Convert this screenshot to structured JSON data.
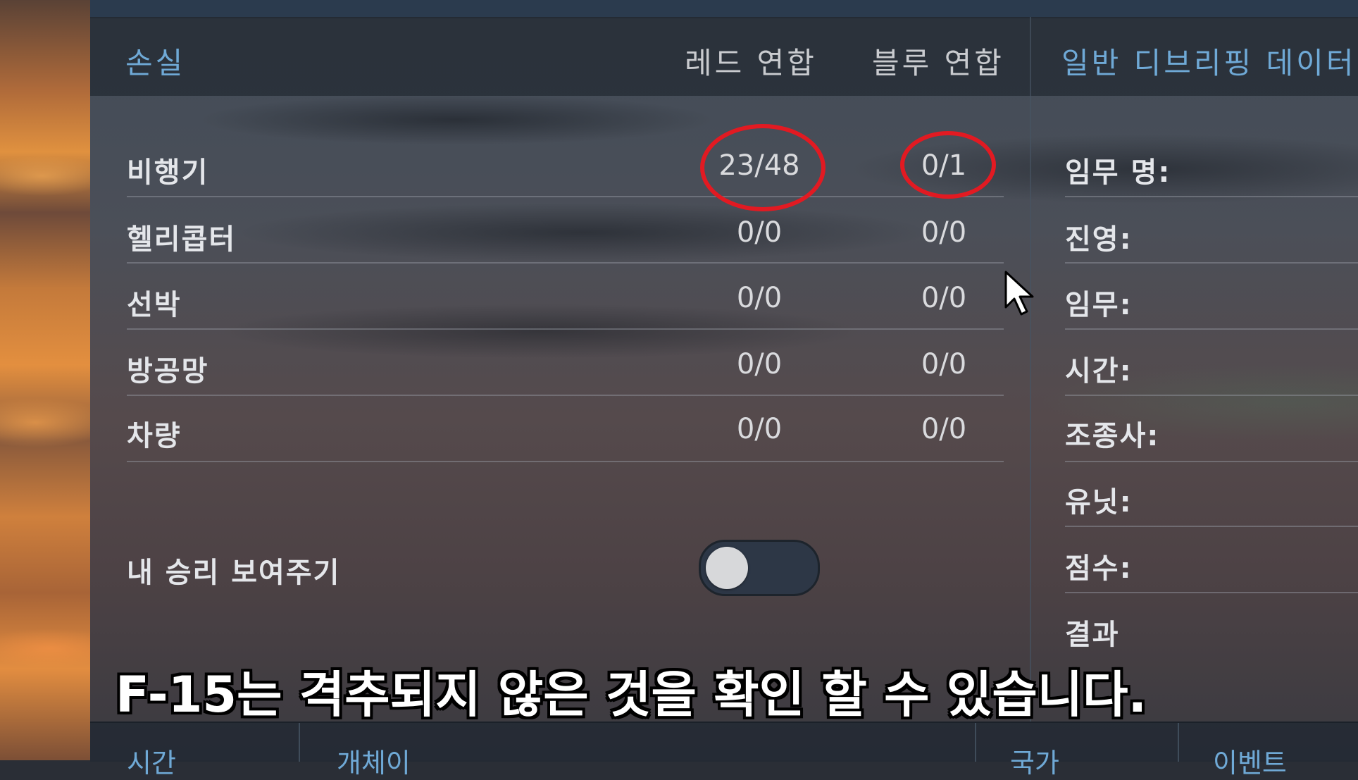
{
  "header": {
    "title": "손실",
    "col_red": "레드 연합",
    "col_blue": "블루 연합",
    "right_title": "일반 디브리핑 데이터"
  },
  "losses": [
    {
      "label": "비행기",
      "red": "23/48",
      "blue": "0/1"
    },
    {
      "label": "헬리콥터",
      "red": "0/0",
      "blue": "0/0"
    },
    {
      "label": "선박",
      "red": "0/0",
      "blue": "0/0"
    },
    {
      "label": "방공망",
      "red": "0/0",
      "blue": "0/0"
    },
    {
      "label": "차량",
      "red": "0/0",
      "blue": "0/0"
    }
  ],
  "toggle": {
    "label": "내 승리 보여주기",
    "on": false
  },
  "debrief_fields": [
    "임무 명:",
    "진영:",
    "임무:",
    "시간:",
    "조종사:",
    "유닛:",
    "점수:",
    "결과"
  ],
  "caption": "F-15는 격추되지 않은 것을 확인 할 수 있습니다.",
  "bottom_tabs": [
    "시간",
    "개체이",
    "국가",
    "이벤트"
  ],
  "colors": {
    "accent": "#6fa9d6",
    "highlight_ring": "#e21a22"
  }
}
